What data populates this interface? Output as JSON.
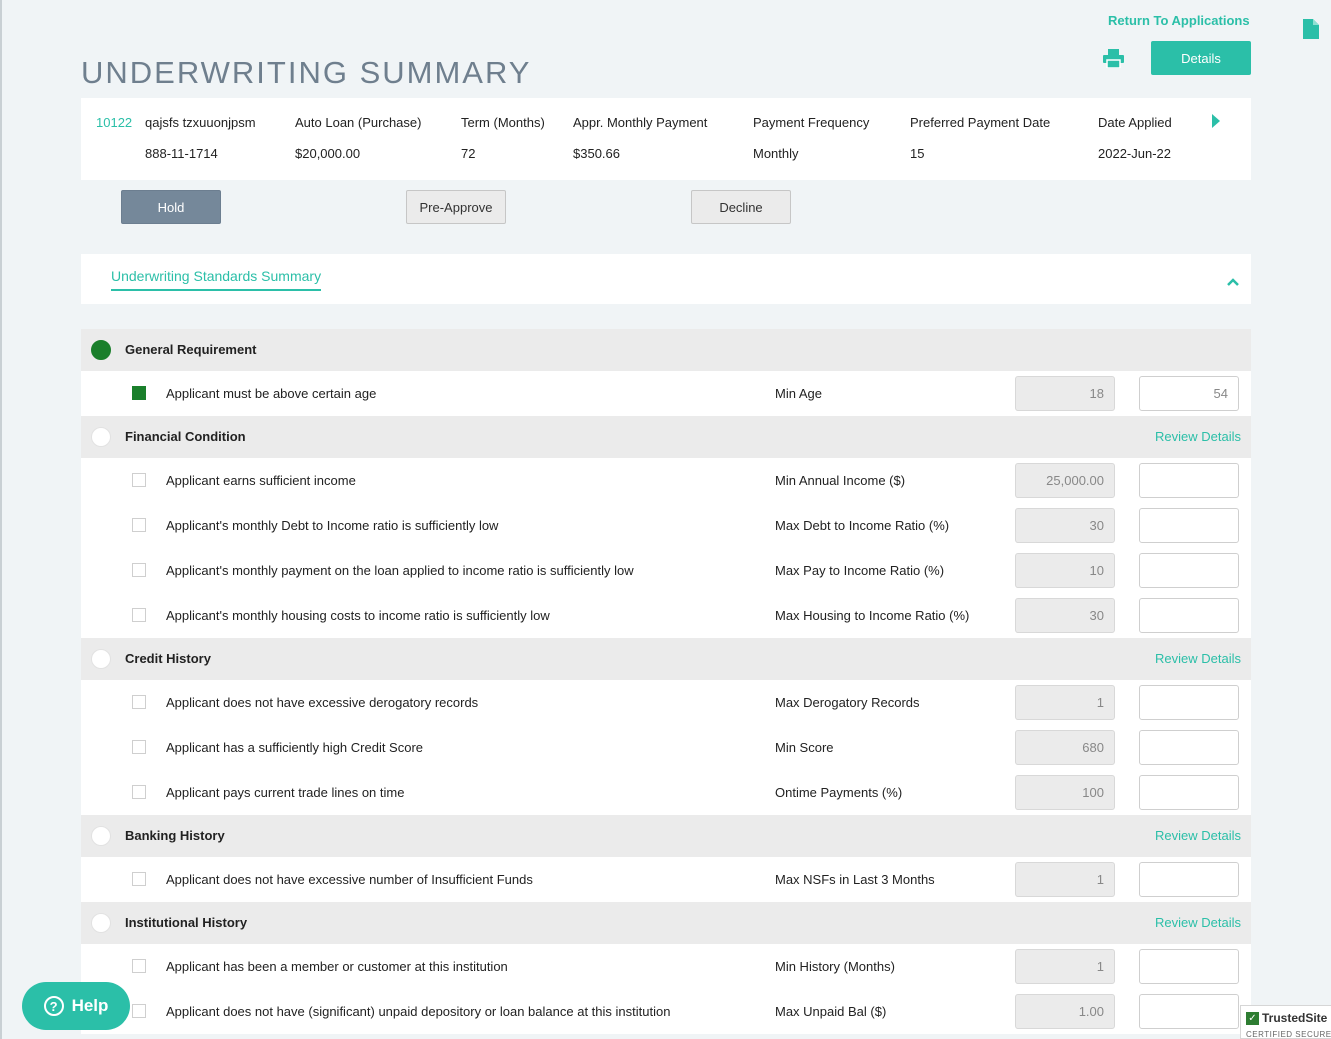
{
  "header": {
    "title": "UNDERWRITING SUMMARY",
    "return_link": "Return To Applications",
    "details_label": "Details",
    "print_icon": "printer-icon",
    "document_icon": "document-icon"
  },
  "application": {
    "id": "10122",
    "applicant_name": "qajsfs tzxuuonjpsm",
    "ssn": "888-11-1714",
    "loan_type": "Auto Loan (Purchase)",
    "amount": "$20,000.00",
    "term_label": "Term (Months)",
    "term_value": "72",
    "payment_label": "Appr. Monthly Payment",
    "payment_value": "$350.66",
    "frequency_label": "Payment Frequency",
    "frequency_value": "Monthly",
    "preferred_label": "Preferred Payment Date",
    "preferred_value": "15",
    "date_label": "Date Applied",
    "date_value": "2022-Jun-22"
  },
  "actions": {
    "hold": "Hold",
    "preapprove": "Pre-Approve",
    "decline": "Decline"
  },
  "standards": {
    "tab_label": "Underwriting Standards Summary",
    "review_label": "Review Details",
    "groups": [
      {
        "title": "General Requirement",
        "met": true,
        "items": [
          {
            "desc": "Applicant must be above certain age",
            "metric": "Min Age",
            "standard": "18",
            "value": "54",
            "checked": true
          }
        ]
      },
      {
        "title": "Financial Condition",
        "met": false,
        "items": [
          {
            "desc": "Applicant earns sufficient income",
            "metric": "Min Annual Income ($)",
            "standard": "25,000.00",
            "value": "",
            "checked": false
          },
          {
            "desc": "Applicant's monthly Debt to Income ratio is sufficiently low",
            "metric": "Max Debt to Income Ratio (%)",
            "standard": "30",
            "value": "",
            "checked": false
          },
          {
            "desc": "Applicant's monthly payment on the loan applied to income ratio is sufficiently low",
            "metric": "Max Pay to Income Ratio (%)",
            "standard": "10",
            "value": "",
            "checked": false
          },
          {
            "desc": "Applicant's monthly housing costs to income ratio is sufficiently low",
            "metric": "Max Housing to Income Ratio (%)",
            "standard": "30",
            "value": "",
            "checked": false
          }
        ]
      },
      {
        "title": "Credit History",
        "met": false,
        "items": [
          {
            "desc": "Applicant does not have excessive derogatory records",
            "metric": "Max Derogatory Records",
            "standard": "1",
            "value": "",
            "checked": false
          },
          {
            "desc": "Applicant has a sufficiently high Credit Score",
            "metric": "Min Score",
            "standard": "680",
            "value": "",
            "checked": false
          },
          {
            "desc": "Applicant pays current trade lines on time",
            "metric": "Ontime Payments (%)",
            "standard": "100",
            "value": "",
            "checked": false
          }
        ]
      },
      {
        "title": "Banking History",
        "met": false,
        "items": [
          {
            "desc": "Applicant does not have excessive number of Insufficient Funds",
            "metric": "Max NSFs in Last 3 Months",
            "standard": "1",
            "value": "",
            "checked": false
          }
        ]
      },
      {
        "title": "Institutional History",
        "met": false,
        "items": [
          {
            "desc": "Applicant has been a member or customer at this institution",
            "metric": "Min History (Months)",
            "standard": "1",
            "value": "",
            "checked": false
          },
          {
            "desc": "Applicant does not have (significant) unpaid depository or loan balance at this institution",
            "metric": "Max Unpaid Bal ($)",
            "standard": "1.00",
            "value": "",
            "checked": false
          }
        ]
      }
    ]
  },
  "help": {
    "label": "Help",
    "icon": "question-icon"
  },
  "trusted": {
    "name": "TrustedSite",
    "sub": "CERTIFIED SECURE"
  },
  "colors": {
    "accent": "#2bbfa8",
    "met": "#1a7f2b",
    "hold": "#75889a"
  }
}
